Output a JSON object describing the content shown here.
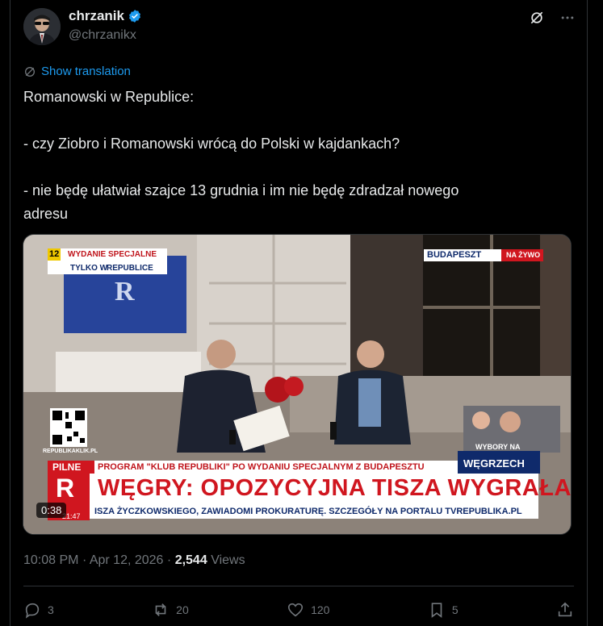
{
  "author": {
    "name": "chrzanik",
    "handle": "@chrzanikx"
  },
  "translation_label": "Show translation",
  "tweet": {
    "line1": "Romanowski w Republice:",
    "line2": "- czy Ziobro i Romanowski wrócą do Polski w kajdankach?",
    "line3a": "- nie będę ułatwiał szajce 13 grudnia i im nie będę zdradzał nowego",
    "line3b": "adresu"
  },
  "video": {
    "channel_number": "12",
    "badge_line1": "WYDANIE SPECJALNE",
    "badge_line2": "TYLKO W",
    "badge_brand": "REPUBLICE",
    "location": "BUDAPESZT",
    "live": "NA ŻYWO",
    "qr_caption": "REPUBLIKAKLIK.PL",
    "inset_line1": "WYBORY NA",
    "inset_line2": "WĘGRZECH",
    "breaking_label": "PILNE",
    "ticker1": "PROGRAM \"KLUB REPUBLIKI\" PO WYDANIU SPECJALNYM Z BUDAPESZTU",
    "headline": "WĘGRY: OPOZYCYJNA TISZA WYGRAŁA",
    "ticker2": "ISZA ŻYCZKOWSKIEGO, ZAWIADOMI PROKURATURĘ. SZCZEGÓŁY NA PORTALU TVREPUBLIKA.PL",
    "logo_letter": "R",
    "clock": "21:47",
    "duration": "0:38"
  },
  "meta": {
    "time": "10:08 PM",
    "sep": "·",
    "date": "Apr 12, 2026",
    "views_count": "2,544",
    "views_label": "Views"
  },
  "actions": {
    "replies": "3",
    "reposts": "20",
    "likes": "120",
    "bookmarks": "5"
  },
  "colors": {
    "accent": "#1d9bf0",
    "tv_red": "#d0161f",
    "tv_navy": "#0f2a6b"
  }
}
